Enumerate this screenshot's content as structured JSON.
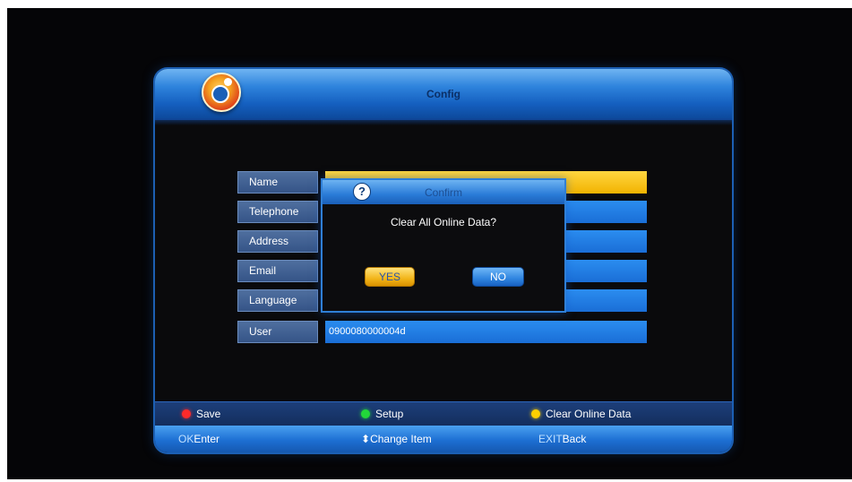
{
  "screen": {
    "title": "Config"
  },
  "form": {
    "rows": [
      {
        "label": "Name",
        "value": "",
        "selected": true
      },
      {
        "label": "Telephone",
        "value": ""
      },
      {
        "label": "Address",
        "value": ""
      },
      {
        "label": "Email",
        "value": ""
      },
      {
        "label": "Language",
        "value": ""
      },
      {
        "label": "User",
        "value": "0900080000004d"
      }
    ]
  },
  "dialog": {
    "title": "Confirm",
    "message": "Clear All Online Data?",
    "yes_label": "YES",
    "no_label": "NO"
  },
  "legend": {
    "red_label": "Save",
    "green_label": "Setup",
    "yellow_label": "Clear Online Data"
  },
  "keys": {
    "ok_key": "OK",
    "ok_action": "Enter",
    "change_icon": "up-down-arrow-icon",
    "change_action": "Change Item",
    "exit_key": "EXIT",
    "exit_action": "Back"
  },
  "colors": {
    "accent_blue": "#2b8df0",
    "selected_yellow": "#f2b300",
    "red": "#ff2a2a",
    "green": "#22d63a",
    "yellow": "#ffd000"
  }
}
